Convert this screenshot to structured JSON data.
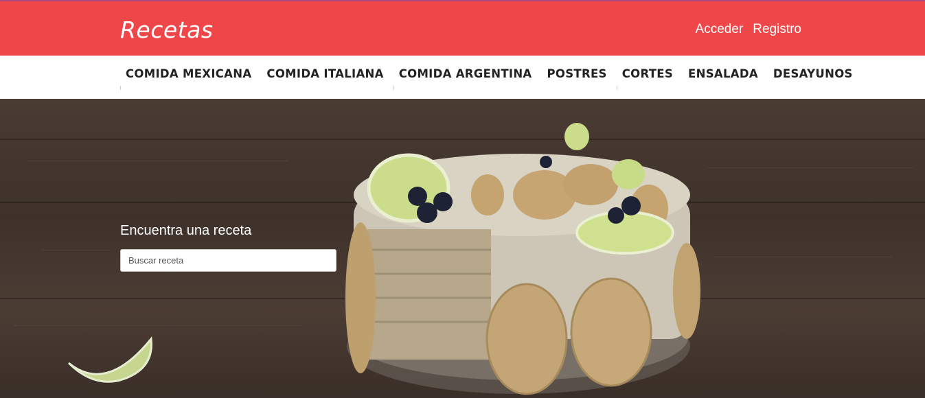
{
  "header": {
    "logo": "Recetas",
    "login_label": "Acceder",
    "register_label": "Registro",
    "brand_color": "#ef4749"
  },
  "nav": {
    "items": [
      {
        "label": "COMIDA MEXICANA"
      },
      {
        "label": "COMIDA ITALIANA"
      },
      {
        "label": "COMIDA ARGENTINA"
      },
      {
        "label": "POSTRES"
      },
      {
        "label": "CORTES"
      },
      {
        "label": "ENSALADA"
      },
      {
        "label": "DESAYUNOS"
      }
    ]
  },
  "hero": {
    "search_title": "Encuentra una receta",
    "search_placeholder": "Buscar receta"
  }
}
